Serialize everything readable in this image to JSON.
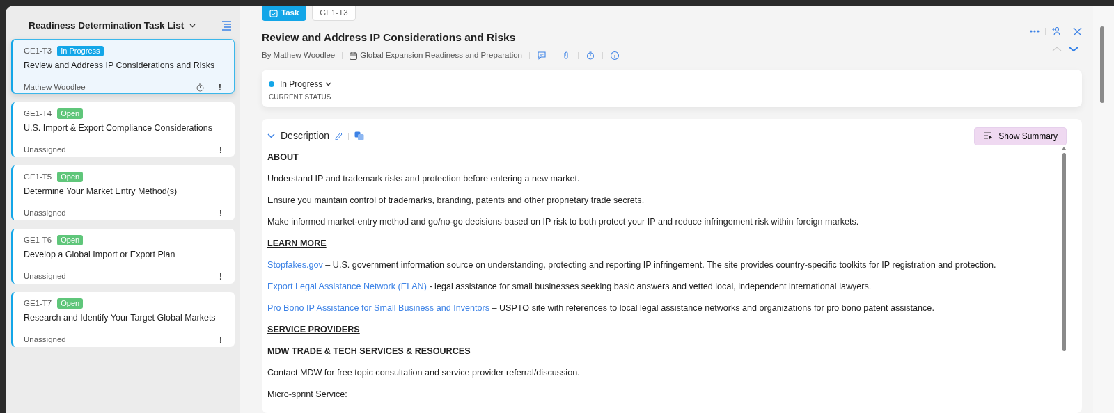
{
  "task_list": {
    "title": "Readiness Determination Task List",
    "tasks": [
      {
        "id": "GE1-T3",
        "status": "In Progress",
        "color": "#13a6e8",
        "title": "Review and Address IP Considerations and Risks",
        "assignee": "Mathew Woodlee",
        "timer": true,
        "priority": "!",
        "selected": true
      },
      {
        "id": "GE1-T4",
        "status": "Open",
        "color": "#5fc67a",
        "title": "U.S. Import & Export Compliance Considerations",
        "assignee": "Unassigned",
        "timer": false,
        "priority": "!",
        "selected": false
      },
      {
        "id": "GE1-T5",
        "status": "Open",
        "color": "#5fc67a",
        "title": "Determine Your Market Entry Method(s)",
        "assignee": "Unassigned",
        "timer": false,
        "priority": "!",
        "selected": false
      },
      {
        "id": "GE1-T6",
        "status": "Open",
        "color": "#5fc67a",
        "title": "Develop a Global Import or Export Plan",
        "assignee": "Unassigned",
        "timer": false,
        "priority": "!",
        "selected": false
      },
      {
        "id": "GE1-T7",
        "status": "Open",
        "color": "#5fc67a",
        "title": "Research and Identify Your Target Global Markets",
        "assignee": "Unassigned",
        "timer": false,
        "priority": "!",
        "selected": false
      }
    ]
  },
  "detail": {
    "tabs": [
      {
        "label": "Task",
        "kind": "type",
        "selected": true
      },
      {
        "label": "GE1-T3",
        "kind": "id",
        "selected": false
      }
    ],
    "title": "Review and Address IP Considerations and Risks",
    "author": "By Mathew Woodlee",
    "project": "Global Expansion Readiness and Preparation",
    "nav": [
      {
        "kind": "previous",
        "disabled": true
      },
      {
        "kind": "next",
        "disabled": false
      }
    ],
    "status": {
      "label": "In Progress",
      "color": "#13a6e8",
      "caption": "CURRENT STATUS"
    },
    "description": {
      "title": "Description",
      "summary_button": "Show Summary",
      "paragraphs": [
        {
          "kind": "heading",
          "parts": [
            {
              "kind": "plain",
              "text": "ABOUT"
            }
          ]
        },
        {
          "kind": "text",
          "parts": [
            {
              "kind": "plain",
              "text": "Understand IP and trademark risks and protection before entering a new market."
            }
          ]
        },
        {
          "kind": "text",
          "parts": [
            {
              "kind": "plain",
              "text": "Ensure you "
            },
            {
              "kind": "underline",
              "text": "maintain control"
            },
            {
              "kind": "plain",
              "text": " of trademarks, branding, patents and other proprietary trade secrets."
            }
          ]
        },
        {
          "kind": "text",
          "parts": [
            {
              "kind": "plain",
              "text": "Make informed market-entry method and go/no-go decisions based on IP risk to both protect your IP and reduce infringement risk within foreign markets."
            }
          ]
        },
        {
          "kind": "heading",
          "parts": [
            {
              "kind": "plain",
              "text": "LEARN MORE"
            }
          ]
        },
        {
          "kind": "text",
          "parts": [
            {
              "kind": "link",
              "text": "Stopfakes.gov"
            },
            {
              "kind": "plain",
              "text": " – U.S. government information source on understanding, protecting and reporting IP infringement. The site provides country-specific toolkits for IP registration and protection."
            }
          ]
        },
        {
          "kind": "text",
          "parts": [
            {
              "kind": "link",
              "text": "Export Legal Assistance Network (ELAN)"
            },
            {
              "kind": "plain",
              "text": " - legal assistance for small businesses seeking basic answers and vetted local, independent international lawyers."
            }
          ]
        },
        {
          "kind": "text",
          "parts": [
            {
              "kind": "link",
              "text": "Pro Bono IP Assistance for Small Business and Inventors"
            },
            {
              "kind": "plain",
              "text": " – USPTO site with references to local legal assistance networks and organizations for pro bono patent assistance."
            }
          ]
        },
        {
          "kind": "heading",
          "parts": [
            {
              "kind": "plain",
              "text": "SERVICE PROVIDERS"
            }
          ]
        },
        {
          "kind": "heading",
          "parts": [
            {
              "kind": "plain",
              "text": "MDW TRADE & TECH SERVICES & RESOURCES"
            }
          ]
        },
        {
          "kind": "text",
          "parts": [
            {
              "kind": "plain",
              "text": "Contact MDW for free topic consultation and service provider referral/discussion."
            }
          ]
        },
        {
          "kind": "text",
          "parts": [
            {
              "kind": "plain",
              "text": "Micro-sprint Service:"
            }
          ]
        }
      ]
    }
  }
}
